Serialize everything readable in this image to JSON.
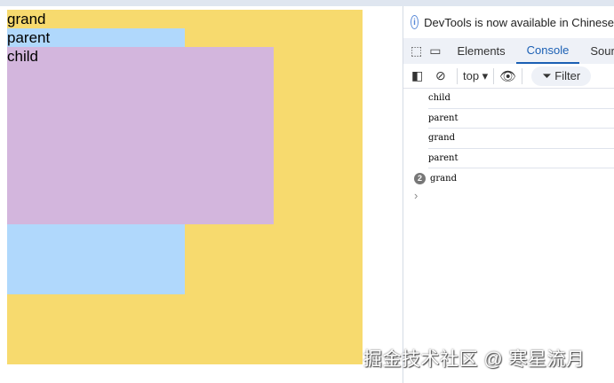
{
  "page": {
    "grand": "grand",
    "parent": "parent",
    "child": "child"
  },
  "devtools": {
    "info": "DevTools is now available in Chinese",
    "tabs": [
      "Elements",
      "Console",
      "Sources"
    ],
    "active_tab": "Console",
    "context": "top ▾",
    "filter": "Filter",
    "logs": [
      {
        "text": "child"
      },
      {
        "text": "parent"
      },
      {
        "text": "grand"
      },
      {
        "text": "parent"
      },
      {
        "text": "grand",
        "count": "2"
      }
    ],
    "prompt": "›"
  },
  "watermark": "掘金技术社区 @ 寒星流月",
  "colors": {
    "grand": "#f7da6e",
    "parent": "#b0d8fc",
    "child": "#d3b6dd",
    "accent": "#1a5fb4"
  }
}
